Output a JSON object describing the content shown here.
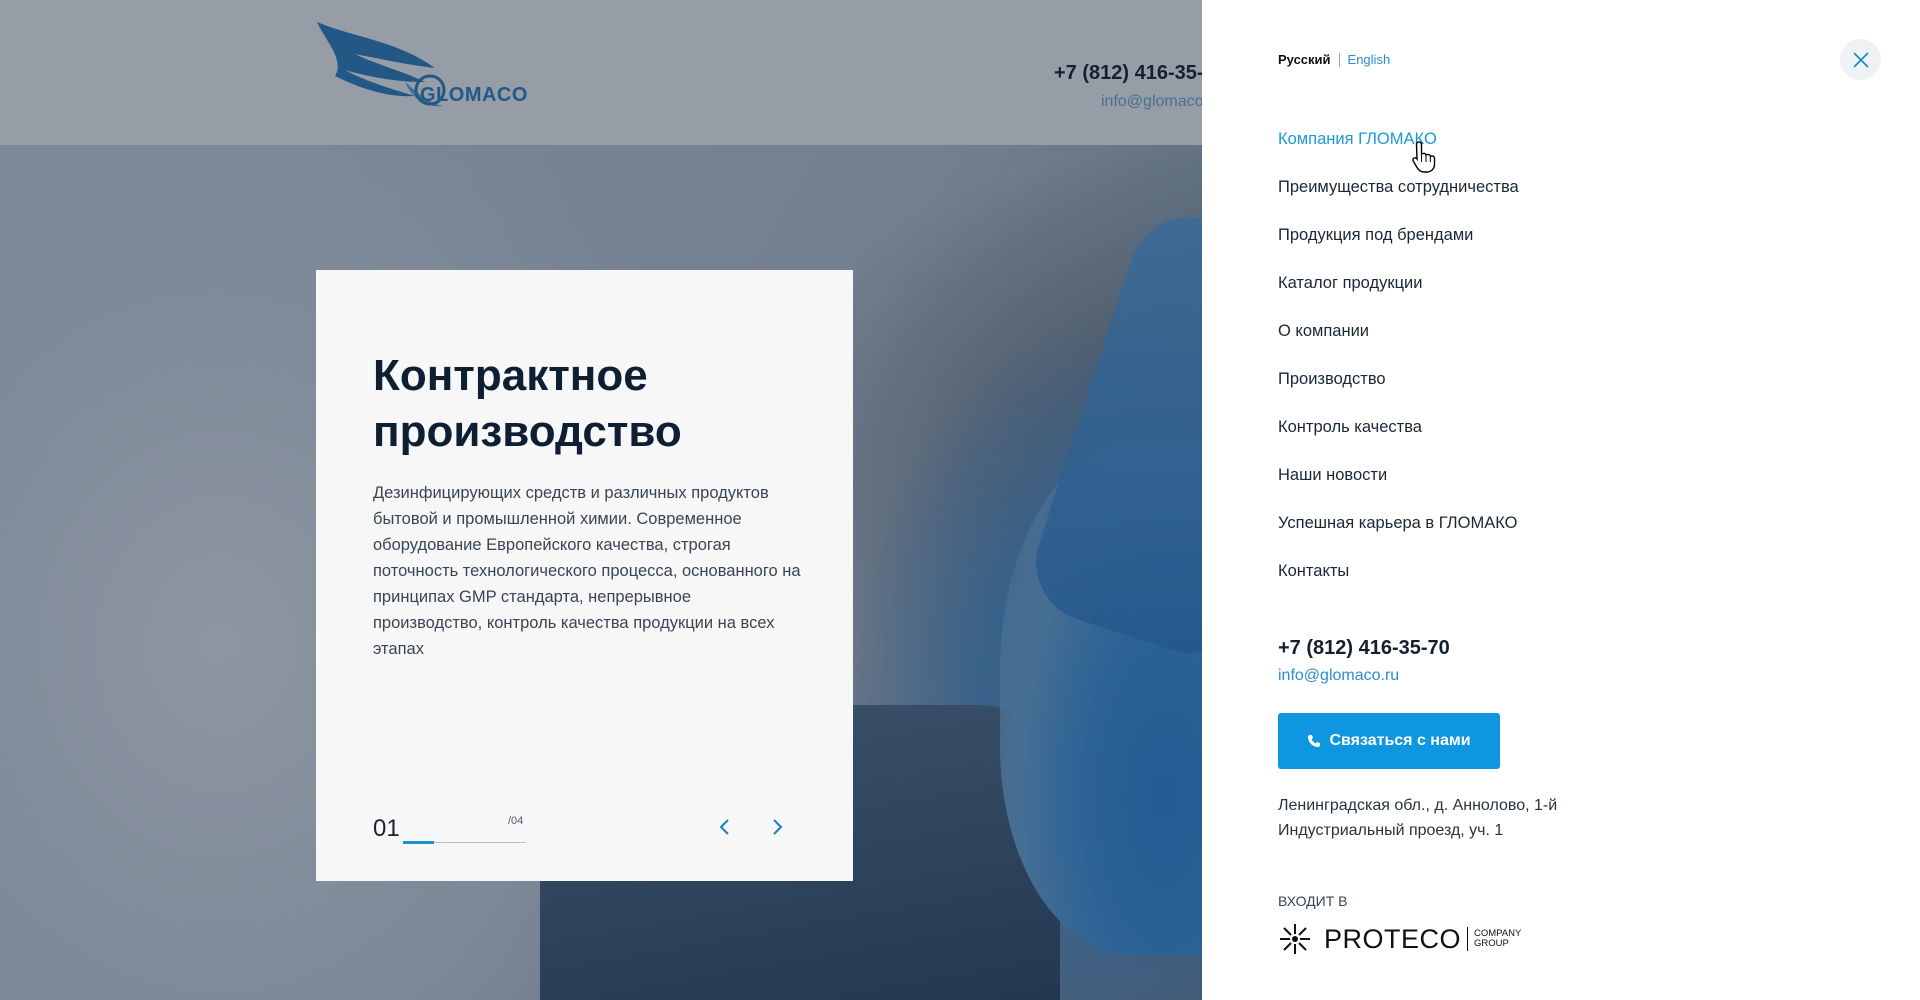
{
  "header": {
    "logo_text": "GLOMACO",
    "phone": "+7 (812) 416-35-7",
    "email": "info@glomaco"
  },
  "hero": {
    "title": "Контрактное производство",
    "description": "Дезинфицирующих средств и различных продуктов бытовой и промышленной химии. Современное оборудование Европейского качества, строгая поточность технологического процесса, основанного на принципах GMP стандарта, непрерывное производство, контроль качества продукции на всех этапах",
    "slide_current": "01",
    "slide_total": "/04",
    "progress": 0.25
  },
  "menu": {
    "lang_ru": "Русский",
    "lang_en": "English",
    "items": [
      {
        "label": "Компания ГЛОМАКО",
        "active": true
      },
      {
        "label": "Преимущества сотрудничества"
      },
      {
        "label": "Продукция под брендами"
      },
      {
        "label": "Каталог продукции"
      },
      {
        "label": "О компании"
      },
      {
        "label": "Производство"
      },
      {
        "label": "Контроль качества"
      },
      {
        "label": "Наши новости"
      },
      {
        "label": "Успешная карьера в ГЛОМАКО"
      },
      {
        "label": "Контакты"
      }
    ],
    "phone": "+7 (812) 416-35-70",
    "email": "info@glomaco.ru",
    "cta_label": "Связаться с нами",
    "address": "Ленинградская обл., д. Аннолово, 1-й Индустриальный проезд, уч. 1",
    "partner_label": "ВХОДИТ В",
    "partner_brand": "PROTECO",
    "partner_sub1": "COMPANY",
    "partner_sub2": "GROUP"
  },
  "colors": {
    "accent": "#0f96e0",
    "link": "#2a8fcf",
    "text": "#1d2733"
  }
}
